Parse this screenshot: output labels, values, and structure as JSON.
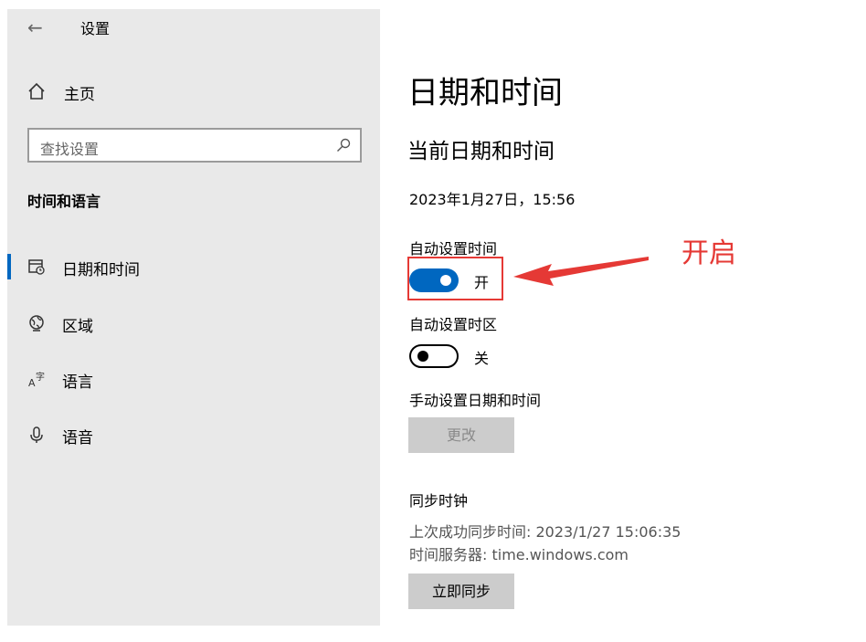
{
  "window": {
    "back_glyph": "←",
    "title": "设置"
  },
  "sidebar": {
    "home_label": "主页",
    "search_placeholder": "查找设置",
    "section_title": "时间和语言",
    "items": [
      {
        "label": "日期和时间",
        "icon": "calendar-clock-icon",
        "selected": true
      },
      {
        "label": "区域",
        "icon": "globe-icon",
        "selected": false
      },
      {
        "label": "语言",
        "icon": "language-icon",
        "selected": false
      },
      {
        "label": "语音",
        "icon": "microphone-icon",
        "selected": false
      }
    ]
  },
  "main": {
    "title": "日期和时间",
    "subtitle": "当前日期和时间",
    "current_datetime": "2023年1月27日，15:56",
    "auto_time": {
      "label": "自动设置时间",
      "state_label": "开",
      "on": true
    },
    "auto_timezone": {
      "label": "自动设置时区",
      "state_label": "关",
      "on": false
    },
    "manual": {
      "label": "手动设置日期和时间",
      "button_label": "更改"
    },
    "sync": {
      "title": "同步时钟",
      "last_sync": "上次成功同步时间: 2023/1/27 15:06:35",
      "server": "时间服务器: time.windows.com",
      "button_label": "立即同步"
    }
  },
  "annotation": {
    "text": "开启",
    "color": "#e53935"
  },
  "colors": {
    "accent": "#0067c0",
    "sidebar_bg": "#e9e9e9",
    "button_bg": "#cccccc"
  }
}
